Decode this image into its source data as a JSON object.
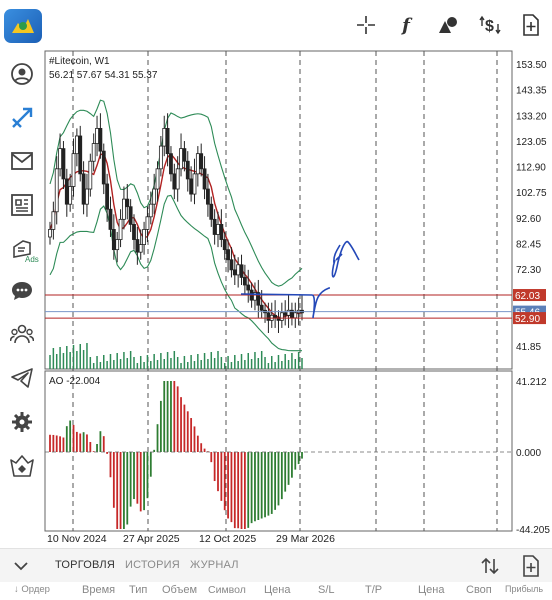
{
  "toolbar": {
    "crosshair_icon": "crosshair-icon",
    "indicators_glyph": "f",
    "objects_icon": "shapes-icon",
    "trade_icon": "dollar-arrows-icon",
    "new_order_icon": "add-document-icon"
  },
  "sidebar": {
    "items": [
      {
        "icon": "account-icon"
      },
      {
        "icon": "trade-arrows-icon"
      },
      {
        "icon": "mail-icon"
      },
      {
        "icon": "news-icon"
      },
      {
        "icon": "ads-icon",
        "label": "Ads"
      },
      {
        "icon": "chat-icon"
      },
      {
        "icon": "community-icon"
      },
      {
        "icon": "telegram-icon"
      },
      {
        "icon": "settings-icon"
      },
      {
        "icon": "mql5-icon"
      }
    ]
  },
  "chart": {
    "symbol": "#Litecoin, W1",
    "ohlc": "56.21 57.67 54.31 55.37",
    "oscillator_label": "AO -22.004",
    "price_ticks": [
      "153.50",
      "143.35",
      "133.20",
      "123.05",
      "112.90",
      "102.75",
      "92.60",
      "82.45",
      "72.30",
      "62.03",
      "55.46",
      "52.90",
      "41.85"
    ],
    "price_tags": [
      {
        "value": "62.03",
        "color": "#c0392b"
      },
      {
        "value": "55.46",
        "color": "#5b7fb8"
      },
      {
        "value": "52.90",
        "color": "#c0392b"
      }
    ],
    "ao_ticks": [
      "41.212",
      "0.000",
      "-44.205"
    ],
    "date_ticks": [
      "10 Nov 2024",
      "27 Apr 2025",
      "12 Oct 2025",
      "29 Mar 2026"
    ],
    "colors": {
      "bands": "#2e8b57",
      "ma": "#b22222",
      "candles": "#222222",
      "drawing": "#2448b8",
      "ao_up": "#2e7d32",
      "ao_down": "#c62828"
    }
  },
  "bottom": {
    "tabs": [
      "ТОРГОВЛЯ",
      "ИСТОРИЯ",
      "ЖУРНАЛ"
    ],
    "columns": [
      "Ордер",
      "Время",
      "Тип",
      "Объем",
      "Символ",
      "Цена",
      "S/L",
      "T/P",
      "Цена",
      "Своп",
      "Прибыль"
    ]
  }
}
